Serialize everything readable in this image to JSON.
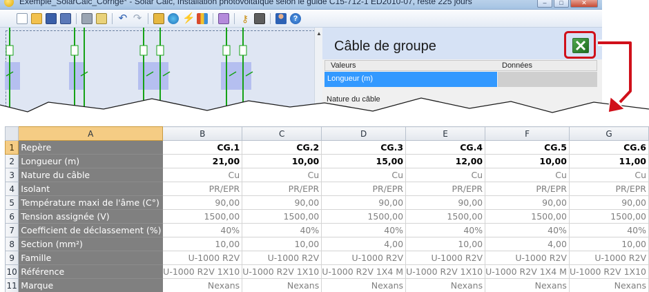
{
  "window": {
    "title": "Exemple_SolarCalc_Corrigé* - Solar Calc, Installation photovoltaïque selon le guide C15-712-1 ED2010-07, reste 225 jours",
    "controls": [
      "–",
      "□",
      "✕"
    ]
  },
  "toolbar": {
    "icons": [
      "new-file-icon",
      "open-folder-icon",
      "save-icon",
      "save-as-icon",
      "print-icon",
      "print-preview-icon",
      "undo-icon",
      "redo-icon",
      "edit-icon",
      "globe-icon",
      "lightning-icon",
      "chart-icon",
      "stack-icon",
      "key-icon",
      "calculator-icon",
      "user-icon",
      "help-icon"
    ]
  },
  "panel": {
    "title": "Câble de groupe",
    "columns": [
      "Valeurs",
      "Données"
    ],
    "selected_row": "Longueur (m)",
    "next_row": "Nature du câble",
    "export_icon": "excel-icon"
  },
  "sheet": {
    "columns": [
      "A",
      "B",
      "C",
      "D",
      "E",
      "F",
      "G"
    ],
    "active_column": "A",
    "bold_rows": [
      0,
      1
    ],
    "rows": [
      {
        "num": "1",
        "label": "Repère",
        "values": [
          "CG.1",
          "CG.2",
          "CG.3",
          "CG.4",
          "CG.5",
          "CG.6"
        ]
      },
      {
        "num": "2",
        "label": "Longueur (m)",
        "values": [
          "21,00",
          "10,00",
          "15,00",
          "12,00",
          "10,00",
          "11,00"
        ]
      },
      {
        "num": "3",
        "label": "Nature du câble",
        "values": [
          "Cu",
          "Cu",
          "Cu",
          "Cu",
          "Cu",
          "Cu"
        ]
      },
      {
        "num": "4",
        "label": "Isolant",
        "values": [
          "PR/EPR",
          "PR/EPR",
          "PR/EPR",
          "PR/EPR",
          "PR/EPR",
          "PR/EPR"
        ]
      },
      {
        "num": "5",
        "label": "Température maxi de l'âme (C°)",
        "values": [
          "90,00",
          "90,00",
          "90,00",
          "90,00",
          "90,00",
          "90,00"
        ]
      },
      {
        "num": "6",
        "label": "Tension assignée (V)",
        "values": [
          "1500,00",
          "1500,00",
          "1500,00",
          "1500,00",
          "1500,00",
          "1500,00"
        ]
      },
      {
        "num": "7",
        "label": "Coefficient de déclassement (%)",
        "values": [
          "40%",
          "40%",
          "40%",
          "40%",
          "40%",
          "40%"
        ]
      },
      {
        "num": "8",
        "label": "Section (mm²)",
        "values": [
          "10,00",
          "10,00",
          "4,00",
          "10,00",
          "4,00",
          "10,00"
        ]
      },
      {
        "num": "9",
        "label": "Famille",
        "values": [
          "U-1000 R2V",
          "U-1000 R2V",
          "U-1000 R2V",
          "U-1000 R2V",
          "U-1000 R2V",
          "U-1000 R2V"
        ]
      },
      {
        "num": "10",
        "label": "Référence",
        "values": [
          "U-1000 R2V 1X10",
          "U-1000 R2V 1X10",
          "U-1000 R2V 1X4 M",
          "U-1000 R2V 1X10",
          "U-1000 R2V 1X4 M",
          "U-1000 R2V 1X10"
        ]
      },
      {
        "num": "11",
        "label": "Marque",
        "values": [
          "Nexans",
          "Nexans",
          "Nexans",
          "Nexans",
          "Nexans",
          "Nexans"
        ]
      }
    ]
  },
  "colors": {
    "highlight_red": "#d0101a",
    "label_fill": "#808080",
    "active_header": "#f5cc84",
    "selection_blue": "#3399ff",
    "panel_header": "#d6e2f5"
  }
}
